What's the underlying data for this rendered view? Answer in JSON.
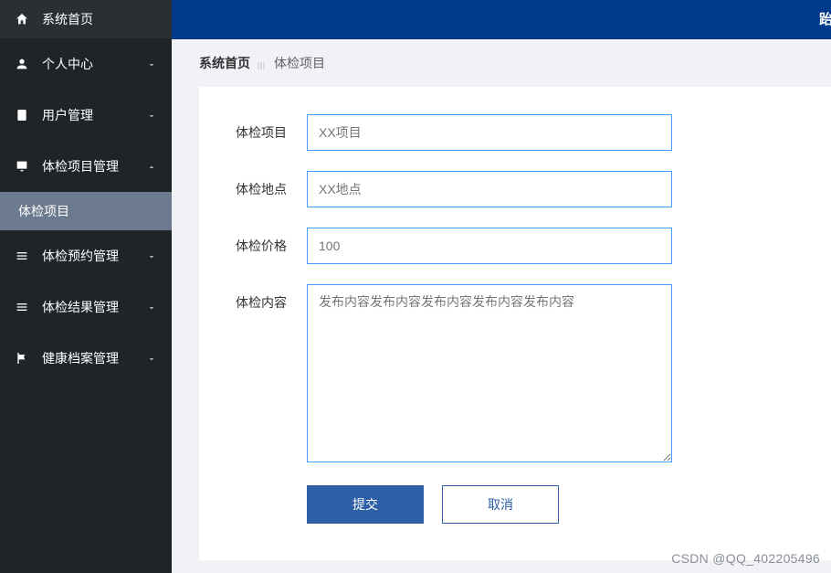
{
  "sidebar": {
    "items": [
      {
        "label": "系统首页",
        "icon": "home"
      },
      {
        "label": "个人中心",
        "icon": "user",
        "expandable": true
      },
      {
        "label": "用户管理",
        "icon": "clipboard",
        "expandable": true
      },
      {
        "label": "体检项目管理",
        "icon": "monitor",
        "expandable": true,
        "expanded": true,
        "children": [
          {
            "label": "体检项目"
          }
        ]
      },
      {
        "label": "体检预约管理",
        "icon": "list",
        "expandable": true
      },
      {
        "label": "体检结果管理",
        "icon": "list",
        "expandable": true
      },
      {
        "label": "健康档案管理",
        "icon": "flag",
        "expandable": true
      }
    ]
  },
  "topbar": {
    "partial_letter": "跆"
  },
  "breadcrumb": {
    "root": "系统首页",
    "current": "体检项目"
  },
  "form": {
    "fields": {
      "project": {
        "label": "体检项目",
        "placeholder": "XX项目",
        "value": ""
      },
      "location": {
        "label": "体检地点",
        "placeholder": "XX地点",
        "value": ""
      },
      "price": {
        "label": "体检价格",
        "placeholder": "100",
        "value": ""
      },
      "content": {
        "label": "体检内容",
        "placeholder": "发布内容发布内容发布内容发布内容发布内容",
        "value": ""
      }
    },
    "buttons": {
      "submit": "提交",
      "cancel": "取消"
    }
  },
  "watermark": "CSDN @QQ_402205496",
  "colors": {
    "sidebar_bg": "#1f2428",
    "topbar_bg": "#003a8c",
    "primary": "#2d5fa7",
    "input_border": "#409eff"
  }
}
